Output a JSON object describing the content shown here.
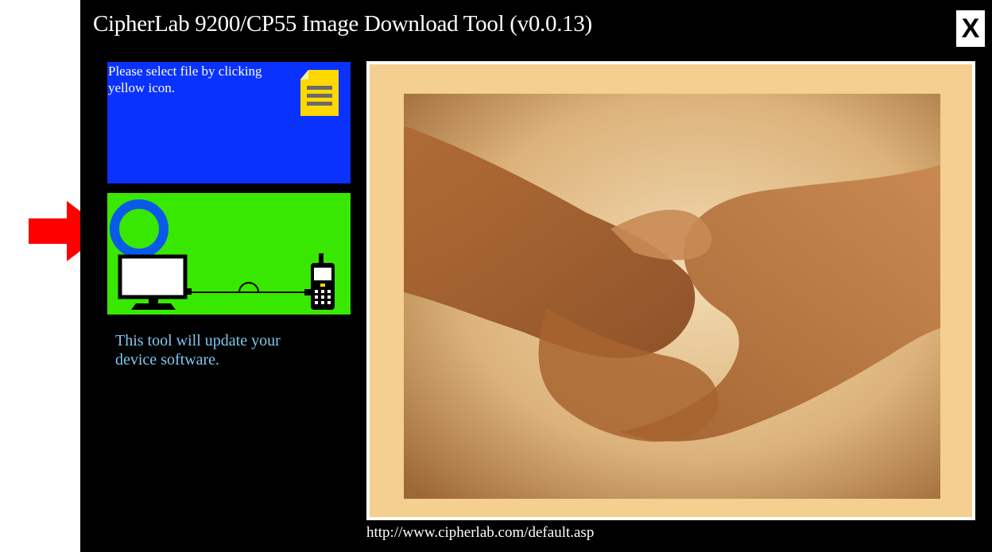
{
  "window": {
    "title": "CipherLab 9200/CP55 Image Download Tool (v0.0.13)",
    "close_label": "X"
  },
  "file_panel": {
    "instruction": "Please select file by clicking yellow icon.",
    "icon": "file-document-icon",
    "color": "#0a32ff"
  },
  "status_panel": {
    "color": "#39e800",
    "icons": [
      "status-ring-icon",
      "monitor-icon",
      "cable-icon",
      "handheld-device-icon"
    ]
  },
  "description": "This tool will update your device software.",
  "banner": {
    "image": "handshake-photo",
    "url": "http://www.cipherlab.com/default.asp"
  },
  "pointer": {
    "icon": "red-arrow-icon",
    "color": "#ff0000"
  }
}
